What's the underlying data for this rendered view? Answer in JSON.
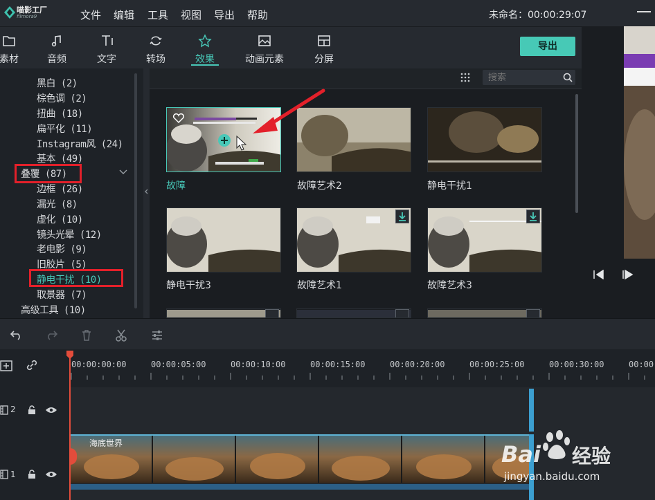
{
  "app": {
    "logo_text": "喵影工厂",
    "logo_sub": "filmora9"
  },
  "menu": [
    "文件",
    "编辑",
    "工具",
    "视图",
    "导出",
    "帮助"
  ],
  "document": {
    "title": "未命名：00:00:29:07"
  },
  "tabs": [
    {
      "label": "素材",
      "icon": "folder-icon"
    },
    {
      "label": "音频",
      "icon": "music-note-icon"
    },
    {
      "label": "文字",
      "icon": "text-icon"
    },
    {
      "label": "转场",
      "icon": "transition-icon"
    },
    {
      "label": "效果",
      "icon": "effects-icon",
      "active": true
    },
    {
      "label": "动画元素",
      "icon": "image-icon"
    },
    {
      "label": "分屏",
      "icon": "split-screen-icon"
    }
  ],
  "export_label": "导出",
  "sidebar": {
    "items": [
      {
        "label": "黑白 (2)"
      },
      {
        "label": "棕色调 (2)"
      },
      {
        "label": "扭曲 (18)"
      },
      {
        "label": "扁平化 (11)"
      },
      {
        "label": "Instagram风 (24)"
      },
      {
        "label": "基本 (49)"
      },
      {
        "label": "叠覆 (87)",
        "group": true
      },
      {
        "label": "边框 (26)"
      },
      {
        "label": "漏光 (8)"
      },
      {
        "label": "虚化 (10)"
      },
      {
        "label": "镜头光晕 (12)"
      },
      {
        "label": "老电影 (9)"
      },
      {
        "label": "旧胶片 (5)"
      },
      {
        "label": "静电干扰 (10)",
        "active": true
      },
      {
        "label": "取景器 (7)"
      },
      {
        "label": "高级工具 (10)",
        "group": true
      }
    ]
  },
  "search": {
    "placeholder": "搜索"
  },
  "effects": [
    {
      "label": "故障",
      "selected": true
    },
    {
      "label": "故障艺术2"
    },
    {
      "label": "静电干扰1"
    },
    {
      "label": "静电干扰3"
    },
    {
      "label": "故障艺术1"
    },
    {
      "label": "故障艺术3"
    }
  ],
  "timeline": {
    "ruler": [
      "00:00:00:00",
      "00:00:05:00",
      "00:00:10:00",
      "00:00:15:00",
      "00:00:20:00",
      "00:00:25:00",
      "00:00:30:00",
      "00:00"
    ],
    "tracks": [
      {
        "number": "2"
      },
      {
        "number": "1"
      }
    ],
    "clip_title": "海底世界"
  },
  "watermark": {
    "brand": "Bai",
    "brand2": "经验",
    "url": "jingyan.baidu.com"
  },
  "colors": {
    "accent": "#48c8b8",
    "highlight_box": "#e3202a",
    "playhead": "#e34c3b"
  }
}
